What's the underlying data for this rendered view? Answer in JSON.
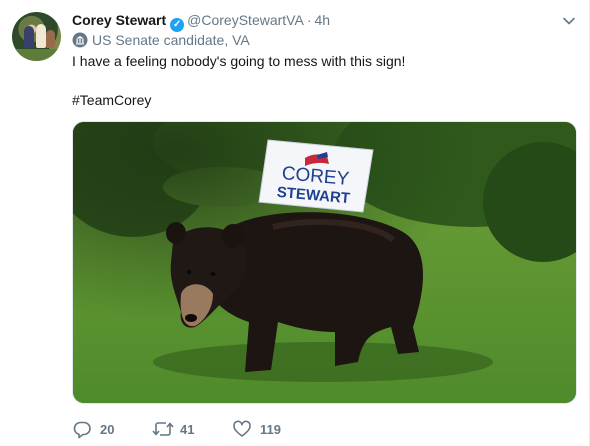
{
  "tweet": {
    "author_name": "Corey Stewart",
    "handle": "@CoreyStewartVA",
    "separator": "·",
    "time": "4h",
    "label": "US Senate candidate, VA",
    "text_line1": "I have a feeling nobody's going to mess with this sign!",
    "hashtag": "#TeamCorey"
  },
  "media": {
    "sign_line1": "COREY",
    "sign_line2": "STEWART"
  },
  "actions": {
    "replies": "20",
    "retweets": "41",
    "likes": "119"
  },
  "icons": {
    "verified": "verified-badge-icon",
    "label": "government-building-icon",
    "menu": "chevron-down-icon",
    "reply": "reply-icon",
    "retweet": "retweet-icon",
    "like": "heart-icon"
  },
  "colors": {
    "verified_blue": "#1da1f2",
    "secondary_text": "#657786",
    "text": "#14171a",
    "sign_blue": "#1f3f8f"
  }
}
